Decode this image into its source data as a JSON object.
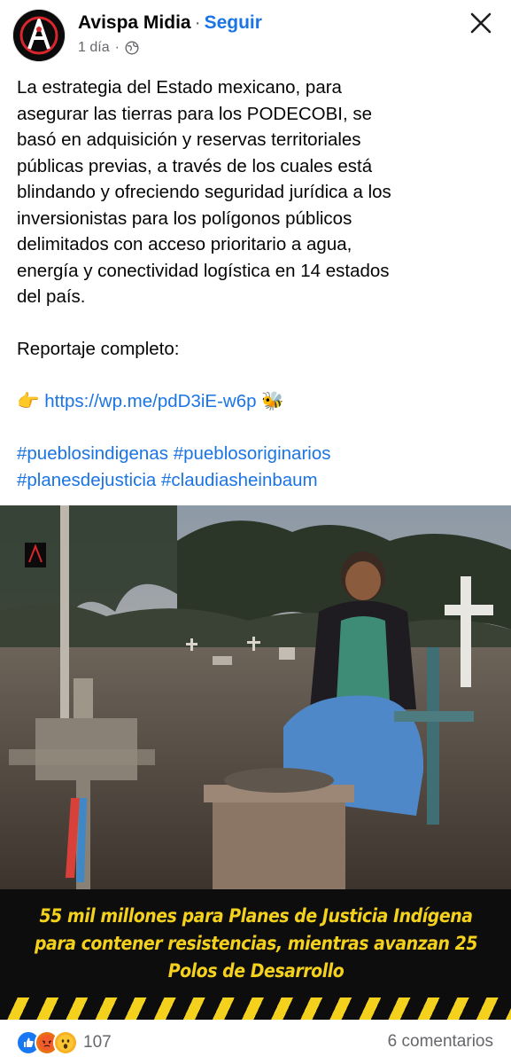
{
  "post": {
    "page_name": "Avispa Midia",
    "separator": "·",
    "follow_label": "Seguir",
    "time": "1 día",
    "visibility_icon": "globe-icon",
    "paragraph": [
      "La estrategia del Estado mexicano, para",
      "asegurar las tierras para los PODECOBI, se",
      "basó en adquisición y reservas territoriales",
      "públicas previas, a través de los cuales está",
      "blindando y ofreciendo seguridad jurídica a los",
      "inversionistas para los polígonos públicos",
      "delimitados con acceso prioritario a agua,",
      "energía y conectividad logística en 14 estados",
      "del país."
    ],
    "report_label": "Reportaje completo:",
    "link_emoji": "👉",
    "link_text": "https://wp.me/pdD3iE-w6p",
    "bee_emoji": "🐝",
    "hashtags": [
      "#pueblosindigenas",
      "#pueblosoriginarios",
      "#planesdejusticia",
      "#claudiasheinbaum"
    ]
  },
  "image": {
    "caption_lines": [
      "55 mil millones para Planes de Justicia Indígena",
      "para contener resistencias, mientras avanzan 25",
      "Polos de Desarrollo"
    ],
    "colors": {
      "caption_text": "#f4d11c",
      "caption_bg": "#0d0d0d"
    }
  },
  "footer": {
    "reaction_icons": [
      "like-icon",
      "angry-icon",
      "wow-icon"
    ],
    "reaction_count": "107",
    "comments_label": "6 comentarios"
  },
  "colors": {
    "link": "#1b74e4",
    "muted": "#65676b",
    "text": "#050505"
  }
}
